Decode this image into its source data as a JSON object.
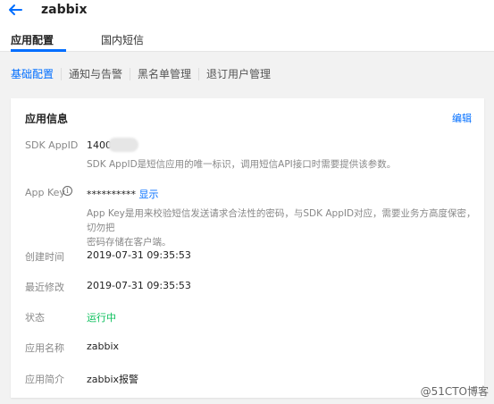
{
  "header": {
    "back_icon": "arrow-left-icon",
    "app_name": "zabbix",
    "tabs": [
      {
        "label": "应用配置",
        "active": true
      },
      {
        "label": "国内短信",
        "active": false
      }
    ]
  },
  "subnav": {
    "items": [
      {
        "label": "基础配置",
        "active": true
      },
      {
        "label": "通知与告警",
        "active": false
      },
      {
        "label": "黑名单管理",
        "active": false
      },
      {
        "label": "退订用户管理",
        "active": false
      }
    ]
  },
  "card": {
    "title": "应用信息",
    "edit_label": "编辑",
    "sdk_appid_label": "SDK AppID",
    "sdk_appid_value": "140023",
    "sdk_appid_desc": "SDK AppID是短信应用的唯一标识，调用短信API接口时需要提供该参数。",
    "appkey_label": "App Key",
    "appkey_value": "**********",
    "appkey_show": "显示",
    "appkey_desc_line1": "App Key是用来校验短信发送请求合法性的密码，与SDK AppID对应，需要业务方高度保密，切勿把",
    "appkey_desc_line2": "密码存储在客户端。",
    "created_label": "创建时间",
    "created_value": "2019-07-31 09:35:53",
    "modified_label": "最近修改",
    "modified_value": "2019-07-31 09:35:53",
    "status_label": "状态",
    "status_value": "运行中",
    "appname_label": "应用名称",
    "appname_value": "zabbix",
    "appdesc_label": "应用简介",
    "appdesc_value": "zabbix报警"
  },
  "watermark": "@51CTO博客",
  "colors": {
    "accent": "#006eff",
    "status_running": "#0abf5b"
  }
}
